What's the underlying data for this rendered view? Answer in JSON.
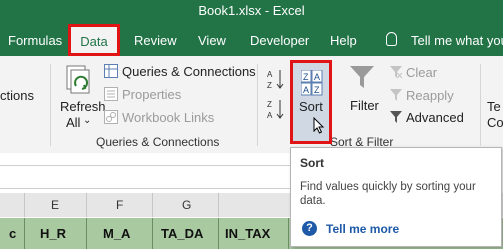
{
  "title": "Book1.xlsx  -  Excel",
  "tabs": {
    "formulas": "Formulas",
    "data": "Data",
    "review": "Review",
    "view": "View",
    "developer": "Developer",
    "help": "Help"
  },
  "tell_me": "Tell me what you",
  "ribbon": {
    "connections_partial": "ctions",
    "refresh_all_line1": "Refresh",
    "refresh_all_line2": "All",
    "queries_connections": "Queries & Connections",
    "properties": "Properties",
    "workbook_links": "Workbook Links",
    "group_queries": "Queries & Connections",
    "sort": "Sort",
    "filter": "Filter",
    "clear": "Clear",
    "reapply": "Reapply",
    "advanced": "Advanced",
    "group_sort_filter": "Sort & Filter",
    "te_partial": "Te",
    "co_partial": "Co"
  },
  "tooltip": {
    "title": "Sort",
    "description": "Find values quickly by sorting your data.",
    "tell_me_more": "Tell me more"
  },
  "columns": [
    "E",
    "F",
    "G"
  ],
  "row": [
    "c",
    "H_R",
    "M_A",
    "TA_DA",
    "IN_TAX"
  ],
  "colors": {
    "excel_green": "#227447",
    "highlight_red": "#e01414",
    "cell_green": "#a9c9a1",
    "link_blue": "#1e5aa8"
  }
}
